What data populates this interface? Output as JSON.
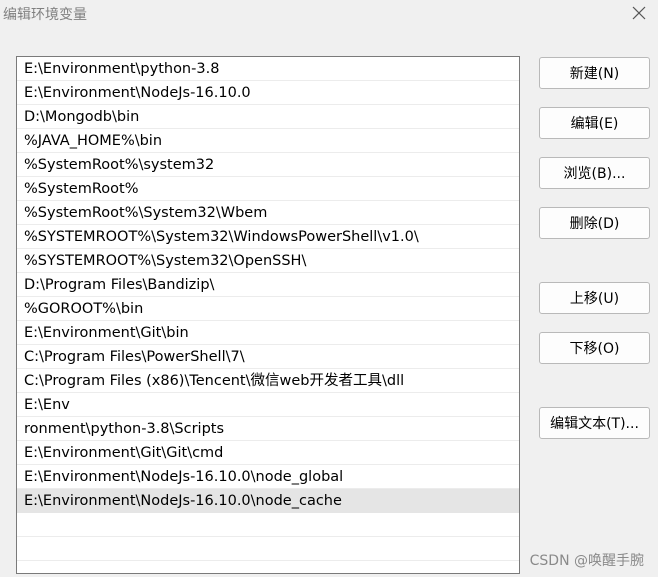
{
  "window": {
    "title": "编辑环境变量",
    "close_icon": "close-icon"
  },
  "path_list": {
    "items": [
      "E:\\Environment\\python-3.8",
      "E:\\Environment\\NodeJs-16.10.0",
      "D:\\Mongodb\\bin",
      "%JAVA_HOME%\\bin",
      "%SystemRoot%\\system32",
      "%SystemRoot%",
      "%SystemRoot%\\System32\\Wbem",
      "%SYSTEMROOT%\\System32\\WindowsPowerShell\\v1.0\\",
      "%SYSTEMROOT%\\System32\\OpenSSH\\",
      "D:\\Program Files\\Bandizip\\",
      "%GOROOT%\\bin",
      "E:\\Environment\\Git\\bin",
      "C:\\Program Files\\PowerShell\\7\\",
      "C:\\Program Files (x86)\\Tencent\\微信web开发者工具\\dll",
      "E:\\Env",
      "ronment\\python-3.8\\Scripts",
      "E:\\Environment\\Git\\Git\\cmd",
      "E:\\Environment\\NodeJs-16.10.0\\node_global",
      "E:\\Environment\\NodeJs-16.10.0\\node_cache"
    ],
    "selected_index": 18
  },
  "buttons": {
    "new": "新建(N)",
    "edit": "编辑(E)",
    "browse": "浏览(B)...",
    "delete": "删除(D)",
    "move_up": "上移(U)",
    "move_down": "下移(O)",
    "edit_text": "编辑文本(T)..."
  },
  "watermark": "CSDN @唤醒手腕"
}
